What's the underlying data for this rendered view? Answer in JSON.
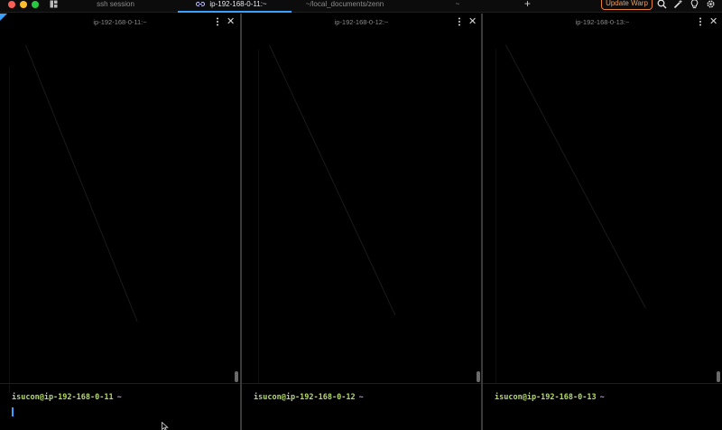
{
  "tabbar": {
    "tabs": [
      {
        "label": "ssh session",
        "active": false
      },
      {
        "label": "ip-192-168-0-11:~",
        "active": true
      },
      {
        "label": "~/local_documents/zenn",
        "active": false
      },
      {
        "label": "~",
        "active": false
      }
    ],
    "new_tab_label": "+",
    "update_label": "Update Warp",
    "icons": [
      "panes-icon",
      "link-icon",
      "search-icon",
      "wand-icon",
      "lightbulb-icon",
      "gear-icon"
    ]
  },
  "panes": [
    {
      "title": "ip-192-168-0-11:~",
      "prompt_user": "isucon@ip-192-168-0-11",
      "prompt_dir": "~",
      "focused": true
    },
    {
      "title": "ip-192-168-0-12:~",
      "prompt_user": "isucon@ip-192-168-0-12",
      "prompt_dir": "~",
      "focused": false
    },
    {
      "title": "ip-192-168-0-13:~",
      "prompt_user": "isucon@ip-192-168-0-13",
      "prompt_dir": "~",
      "focused": false
    }
  ],
  "pane_close_label": "✕",
  "colors": {
    "accent": "#3aa0ff",
    "prompt_user": "#b5d86b",
    "prompt_dir": "#c98ee6",
    "update_border": "#e8813a"
  }
}
